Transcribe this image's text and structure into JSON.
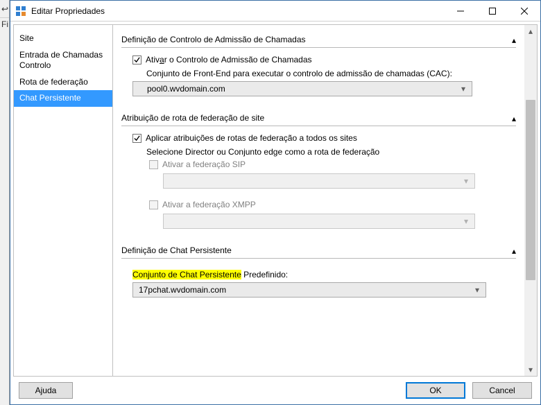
{
  "parent": {
    "toolbar_icon": "↩",
    "fi": "Fi"
  },
  "window": {
    "title": "Editar Propriedades"
  },
  "sidebar": {
    "items": [
      "Site",
      "Entrada de Chamadas Controlo",
      "Rota de federação",
      "Chat Persistente"
    ]
  },
  "sections": {
    "cac": {
      "title": "Definição de Controlo de Admissão de Chamadas",
      "enable_label_pre": "Ativ",
      "enable_label_u": "a",
      "enable_label_post": "r o Controlo de Admissão de Chamadas",
      "pool_label": "Conjunto de Front-End para executar o controlo de admissão de chamadas (CAC):",
      "pool_value": "pool0.wvdomain.com"
    },
    "fed": {
      "title": "Atribuição de rota de federação de site",
      "apply_label": "Aplicar atribuições de rotas de federação a todos os sites",
      "select_label": "Selecione Director ou Conjunto edge como a rota de federação",
      "sip_label": "Ativar a federação SIP",
      "xmpp_label": "Ativar a federação XMPP"
    },
    "pc": {
      "title": "Definição de Chat Persistente",
      "pool_label_hl": "Conjunto de Chat Persistente",
      "pool_label_rest": " Predefinido:",
      "pool_value": "17pchat.wvdomain.com"
    }
  },
  "buttons": {
    "help": "Ajuda",
    "ok": "OK",
    "cancel": "Cancel"
  }
}
